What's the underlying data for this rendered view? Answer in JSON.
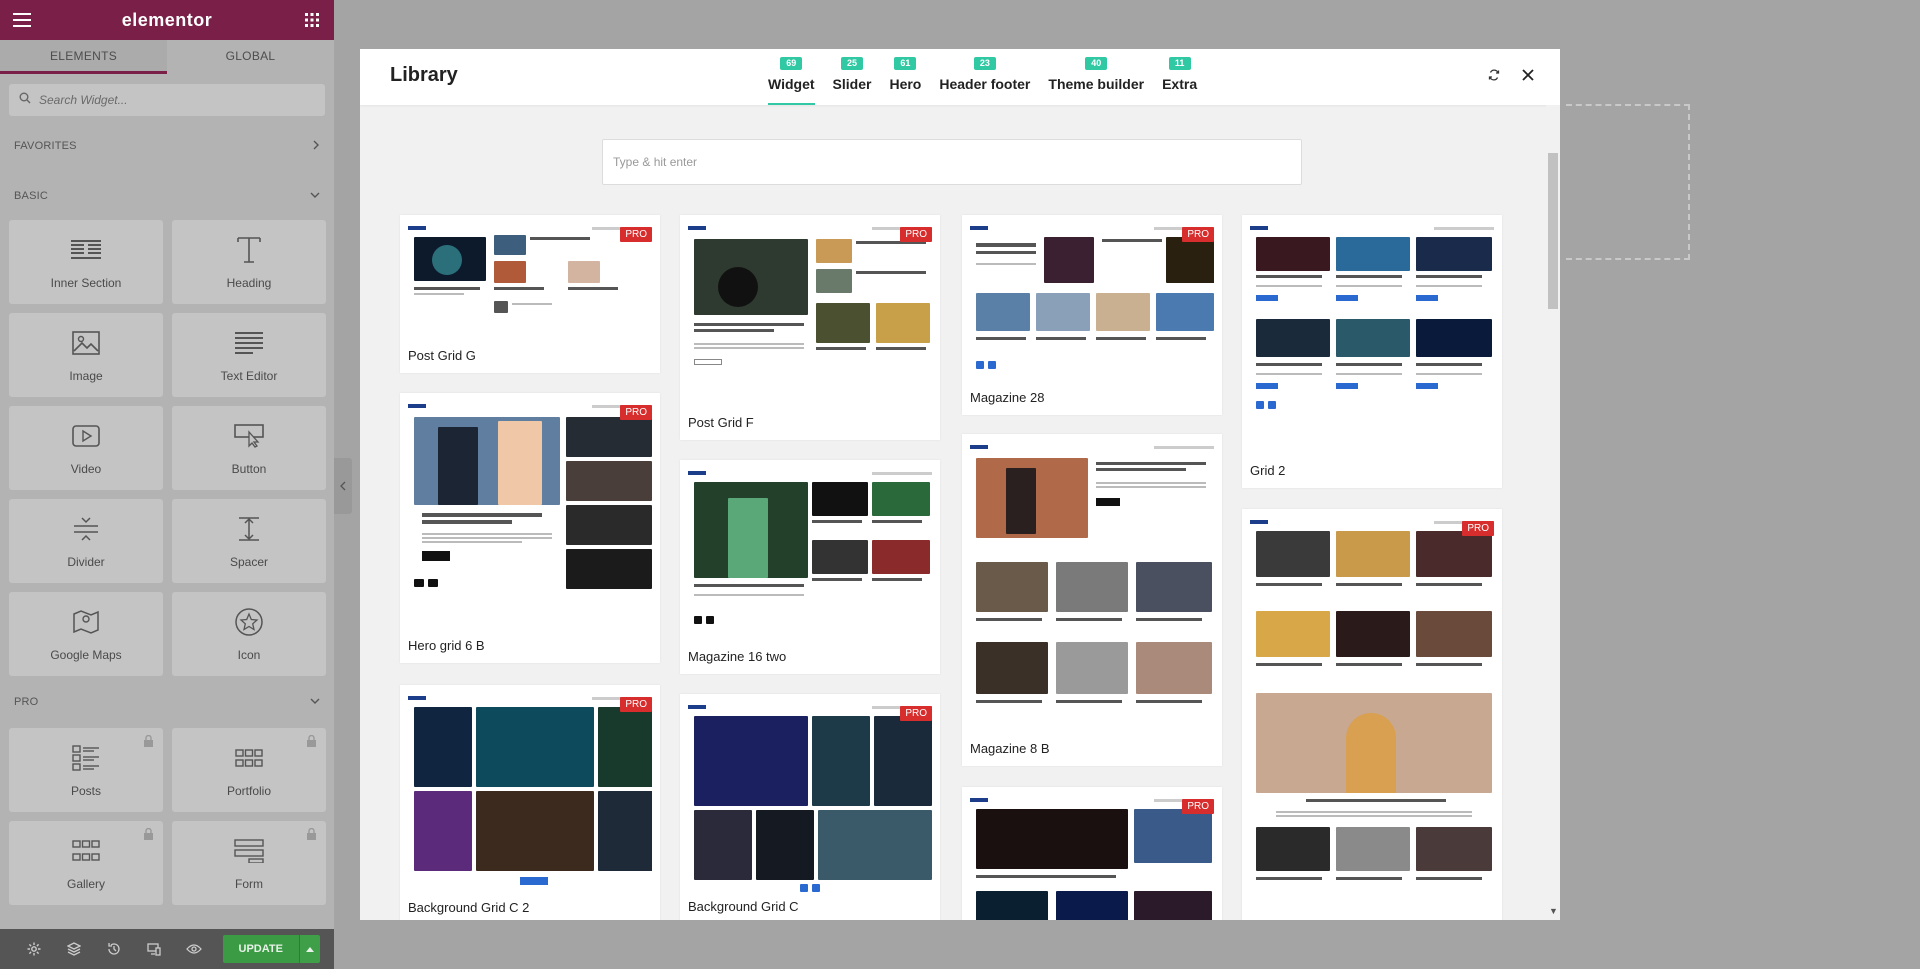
{
  "sidebar": {
    "brand": "elementor",
    "tabs": [
      {
        "label": "ELEMENTS"
      },
      {
        "label": "GLOBAL"
      }
    ],
    "search_placeholder": "Search Widget...",
    "categories": {
      "favorites": "FAVORITES",
      "basic": "BASIC",
      "pro": "PRO"
    },
    "basic_widgets": [
      {
        "label": "Inner Section",
        "icon": "inner-section-icon"
      },
      {
        "label": "Heading",
        "icon": "heading-icon"
      },
      {
        "label": "Image",
        "icon": "image-icon"
      },
      {
        "label": "Text Editor",
        "icon": "text-editor-icon"
      },
      {
        "label": "Video",
        "icon": "video-icon"
      },
      {
        "label": "Button",
        "icon": "button-icon"
      },
      {
        "label": "Divider",
        "icon": "divider-icon"
      },
      {
        "label": "Spacer",
        "icon": "spacer-icon"
      },
      {
        "label": "Google Maps",
        "icon": "google-maps-icon"
      },
      {
        "label": "Icon",
        "icon": "star-icon"
      }
    ],
    "pro_widgets": [
      {
        "label": "Posts",
        "icon": "posts-icon"
      },
      {
        "label": "Portfolio",
        "icon": "portfolio-icon"
      },
      {
        "label": "Gallery",
        "icon": "gallery-icon"
      },
      {
        "label": "Form",
        "icon": "form-icon"
      }
    ],
    "update_label": "UPDATE"
  },
  "library": {
    "title": "Library",
    "tabs": [
      {
        "label": "Widget",
        "count": "69"
      },
      {
        "label": "Slider",
        "count": "25"
      },
      {
        "label": "Hero",
        "count": "61"
      },
      {
        "label": "Header footer",
        "count": "23"
      },
      {
        "label": "Theme builder",
        "count": "40"
      },
      {
        "label": "Extra",
        "count": "11"
      }
    ],
    "search_placeholder": "Type & hit enter",
    "pro_badge": "PRO",
    "cards": [
      "Post Grid G",
      "Hero grid 6 B",
      "Background Grid C 2",
      "Post Grid F",
      "Magazine 16 two",
      "Background Grid C",
      "Magazine 28",
      "Magazine 8 B",
      "Grid 2"
    ]
  },
  "colors": {
    "brand": "#7a1f47",
    "accent": "#30c9a3",
    "pro_badge": "#d72d2d",
    "update": "#3a9b44"
  }
}
